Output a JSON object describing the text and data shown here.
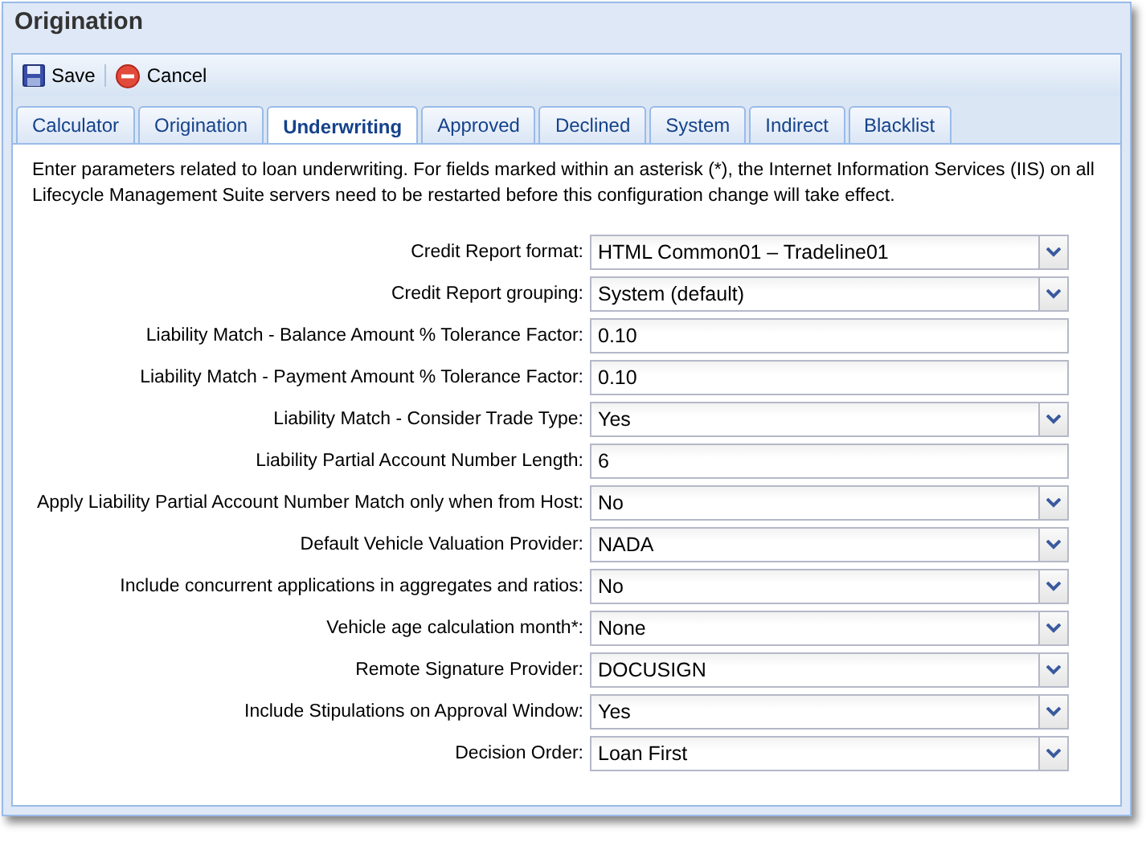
{
  "window": {
    "title": "Origination"
  },
  "toolbar": [
    {
      "kind": "save",
      "label": "Save"
    },
    {
      "kind": "cancel",
      "label": "Cancel"
    }
  ],
  "tabs": [
    {
      "label": "Calculator",
      "selected": false
    },
    {
      "label": "Origination",
      "selected": false
    },
    {
      "label": "Underwriting",
      "selected": true
    },
    {
      "label": "Approved",
      "selected": false
    },
    {
      "label": "Declined",
      "selected": false
    },
    {
      "label": "System",
      "selected": false
    },
    {
      "label": "Indirect",
      "selected": false
    },
    {
      "label": "Blacklist",
      "selected": false
    }
  ],
  "description": "Enter parameters related to loan underwriting. For fields marked within an asterisk (*), the Internet Information Services (IIS) on all Lifecycle Management Suite servers need to be restarted before this configuration change will take effect.",
  "fields": [
    {
      "kind": "dropdown",
      "label": "Credit Report format:",
      "value": "HTML Common01 – Tradeline01"
    },
    {
      "kind": "dropdown",
      "label": "Credit Report grouping:",
      "value": "System (default)"
    },
    {
      "kind": "text",
      "label": "Liability Match - Balance Amount % Tolerance Factor:",
      "value": "0.10"
    },
    {
      "kind": "text",
      "label": "Liability Match - Payment Amount % Tolerance Factor:",
      "value": "0.10"
    },
    {
      "kind": "dropdown",
      "label": "Liability Match - Consider Trade Type:",
      "value": "Yes"
    },
    {
      "kind": "text",
      "label": "Liability Partial Account Number Length:",
      "value": "6"
    },
    {
      "kind": "dropdown",
      "label": "Apply Liability Partial Account Number Match only when from Host:",
      "value": "No"
    },
    {
      "kind": "dropdown",
      "label": "Default Vehicle Valuation Provider:",
      "value": "NADA"
    },
    {
      "kind": "dropdown",
      "label": "Include concurrent applications in aggregates and ratios:",
      "value": "No"
    },
    {
      "kind": "dropdown",
      "label": "Vehicle age calculation month*:",
      "value": "None"
    },
    {
      "kind": "dropdown",
      "label": "Remote Signature Provider:",
      "value": "DOCUSIGN"
    },
    {
      "kind": "dropdown",
      "label": "Include Stipulations on Approval Window:",
      "value": "Yes"
    },
    {
      "kind": "dropdown",
      "label": "Decision Order:",
      "value": "Loan First"
    }
  ]
}
